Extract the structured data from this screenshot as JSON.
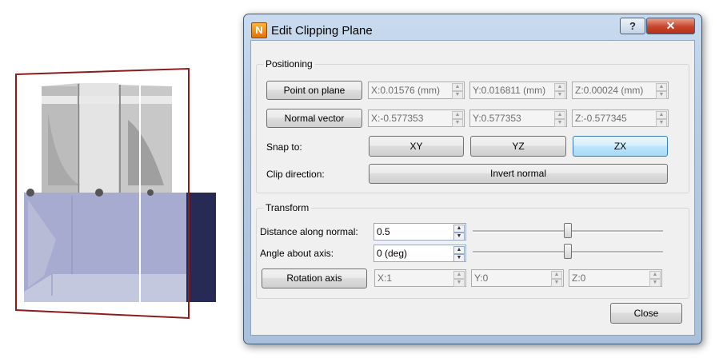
{
  "dialog": {
    "title": "Edit Clipping Plane",
    "app_icon": "N",
    "help_label": "?",
    "close_glyph": "✕"
  },
  "positioning": {
    "group_title": "Positioning",
    "point_button": "Point on plane",
    "point_x": "X:0.01576 (mm)",
    "point_y": "Y:0.016811 (mm)",
    "point_z": "Z:0.00024 (mm)",
    "normal_button": "Normal vector",
    "normal_x": "X:-0.577353",
    "normal_y": "Y:0.577353",
    "normal_z": "Z:-0.577345",
    "snap_label": "Snap to:",
    "snap_xy": "XY",
    "snap_yz": "YZ",
    "snap_zx": "ZX",
    "clip_label": "Clip direction:",
    "invert_button": "Invert normal"
  },
  "transform": {
    "group_title": "Transform",
    "distance_label": "Distance along normal:",
    "distance_value": "0.5",
    "distance_slider": 0.5,
    "angle_label": "Angle about axis:",
    "angle_value": "0 (deg)",
    "angle_slider": 0.5,
    "rotation_button": "Rotation axis",
    "axis_x": "X:1",
    "axis_y": "Y:0",
    "axis_z": "Z:0"
  },
  "footer": {
    "close_button": "Close"
  },
  "colors": {
    "plane_outline": "#8b1c1c",
    "clip_box": "#9a9ec2",
    "clip_box_dark": "#2b2f5a",
    "focus_blue": "#3c7fb1"
  }
}
